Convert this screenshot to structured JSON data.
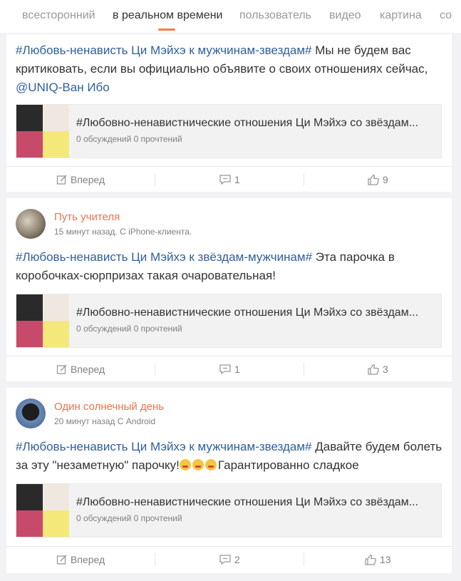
{
  "tabs": [
    {
      "label": "всесторонний"
    },
    {
      "label": "в реальном времени"
    },
    {
      "label": "пользователь"
    },
    {
      "label": "видео"
    },
    {
      "label": "картина"
    },
    {
      "label": "со"
    }
  ],
  "posts": [
    {
      "text": {
        "tag": "#Любовь-ненависть Ци Мэйхэ к мужчинам-звездам#",
        "body": " Мы не будем вас критиковать, если вы официально объявите о своих отношениях сейчас, ",
        "mention": "@UNIQ-Ван Ибо"
      },
      "share": {
        "title": "#Любовно-ненавистнические отношения Ци Мэйхэ со звёздам...",
        "stats": "0 обсуждений 0 прочтений"
      },
      "actions": {
        "forward": "Вперед",
        "comments": "1",
        "likes": "9"
      }
    },
    {
      "user": {
        "name": "Путь учителя",
        "meta": "15 минут назад. С iPhone-клиента."
      },
      "text": {
        "tag": "#Любовь-ненависть Ци Мэйхэ к звёздам-мужчинам#",
        "body": " Эта парочка в коробочках-сюрпризах такая очаровательная!"
      },
      "share": {
        "title": "#Любовно-ненавистнические отношения Ци Мэйхэ со звёздам...",
        "stats": "0 обсуждений 0 прочтений"
      },
      "actions": {
        "forward": "Вперед",
        "comments": "1",
        "likes": "3"
      }
    },
    {
      "user": {
        "name": "Один солнечный день",
        "meta": "20 минут назад С Android"
      },
      "text": {
        "tag": "#Любовь-ненависть Ци Мэйхэ к мужчинам-звездам#",
        "body": " Давайте будем болеть за эту \"незаметную\" парочку!",
        "after_emoji": "Гарантированно сладкое"
      },
      "share": {
        "title": "#Любовно-ненавистнические отношения Ци Мэйхэ со звёздам...",
        "stats": "0 обсуждений 0 прочтений"
      },
      "actions": {
        "forward": "Вперед",
        "comments": "2",
        "likes": "13"
      }
    }
  ],
  "icons": {
    "forward": "share-edit-icon",
    "comment": "comment-icon",
    "like": "thumbs-up-icon",
    "emoji": "face-emoji-icon"
  },
  "colors": {
    "accent": "#fa7d3c",
    "username": "#eb7350",
    "hashtag": "#2f5f9e"
  }
}
